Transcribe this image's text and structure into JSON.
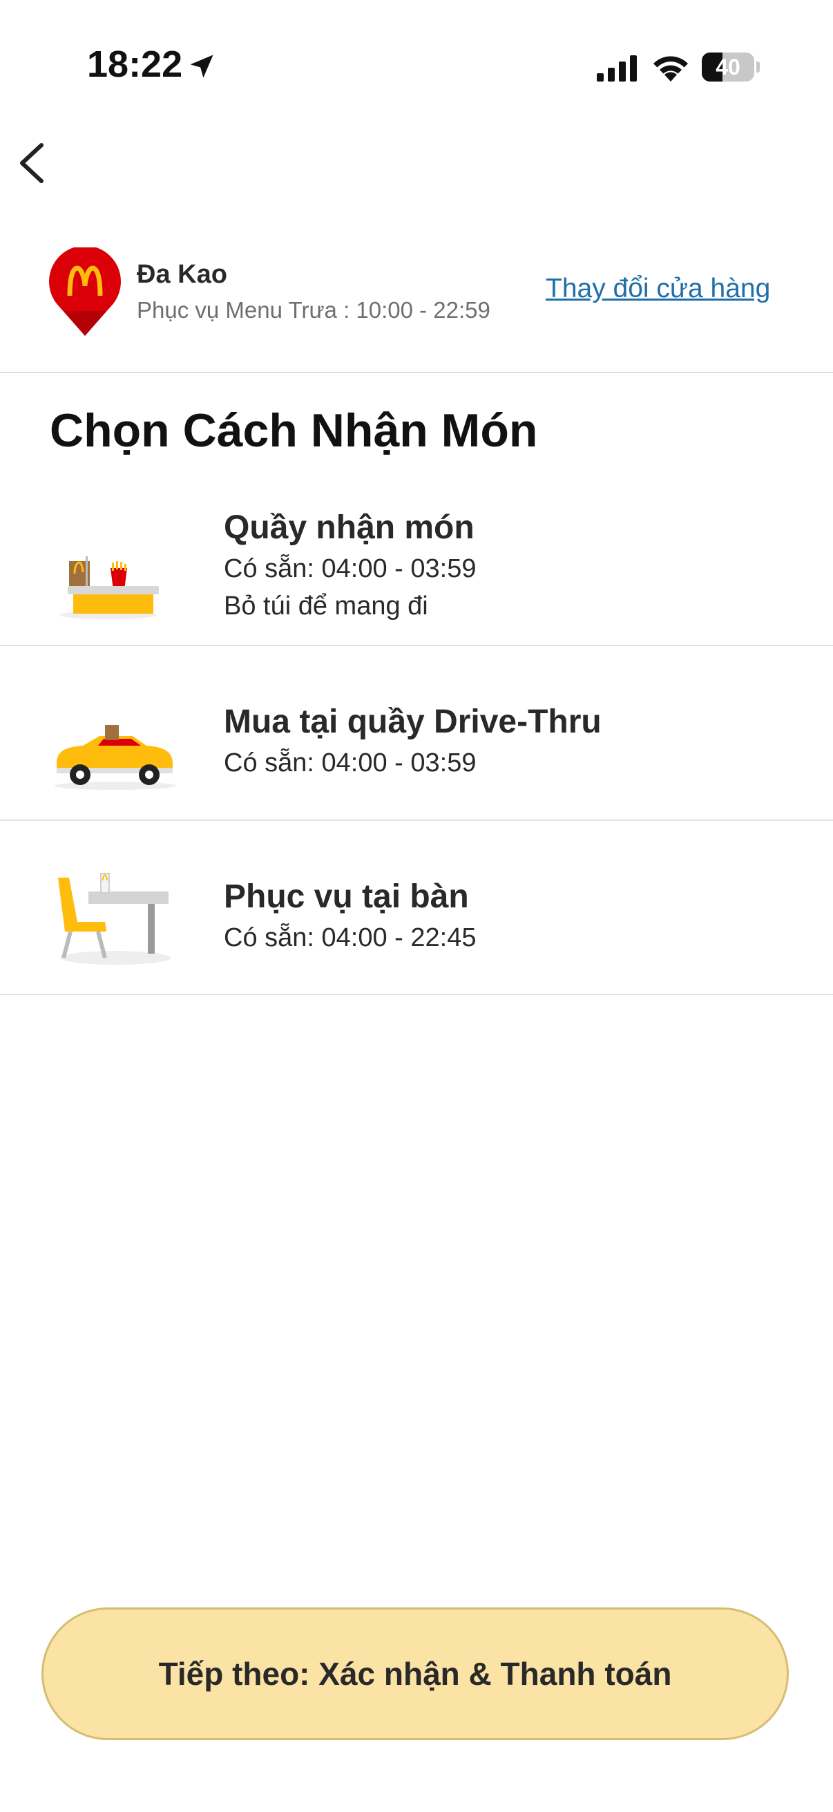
{
  "status_bar": {
    "time": "18:22",
    "battery_level": "40",
    "battery_fraction": 0.4,
    "icons": [
      "location-arrow-icon",
      "cellular-signal-icon",
      "wifi-icon",
      "battery-icon"
    ]
  },
  "header": {
    "back_icon": "chevron-left-icon"
  },
  "store": {
    "name": "Đa Kao",
    "hours": "Phục vụ Menu Trưa : 10:00 - 22:59",
    "change_label": "Thay đổi cửa hàng",
    "logo_icon": "mcdonalds-pin-icon"
  },
  "title": "Chọn Cách Nhận Món",
  "options": [
    {
      "title": "Quầy nhận món",
      "availability": "Có sẵn: 04:00 - 03:59",
      "note": "Bỏ túi để mang đi",
      "icon": "counter-pickup-icon"
    },
    {
      "title": "Mua tại quầy Drive-Thru",
      "availability": "Có sẵn: 04:00 - 03:59",
      "icon": "drive-thru-car-icon"
    },
    {
      "title": "Phục vụ tại bàn",
      "availability": "Có sẵn: 04:00 - 22:45",
      "icon": "table-service-icon"
    }
  ],
  "next_button": {
    "label": "Tiếp theo: Xác nhận & Thanh toán"
  },
  "colors": {
    "accent_yellow": "#ffbc0d",
    "mcd_red": "#db0007",
    "link_blue": "#1f6fa8",
    "button_bg": "#fae3a5"
  }
}
